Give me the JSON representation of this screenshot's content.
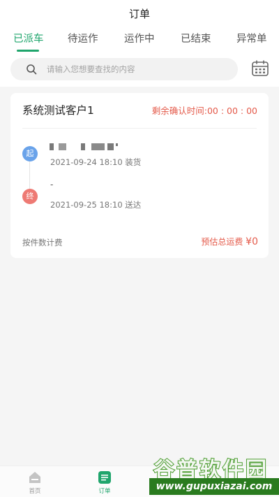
{
  "header": {
    "title": "订单",
    "tabs": [
      {
        "label": "已派车",
        "active": true
      },
      {
        "label": "待运作",
        "active": false
      },
      {
        "label": "运作中",
        "active": false
      },
      {
        "label": "已结束",
        "active": false
      },
      {
        "label": "异常单",
        "active": false
      }
    ]
  },
  "search": {
    "placeholder": "请输入您想要查找的内容",
    "icon": "search-icon",
    "calendar_icon": "calendar-icon"
  },
  "order": {
    "client": "系统测试客户1",
    "countdown_label": "剩余确认时间:",
    "countdown_value": "00 : 00 : 00",
    "start_badge": "起",
    "end_badge": "终",
    "end_address": "-",
    "load_time": "2021-09-24 18:10",
    "load_action": "装货",
    "deliver_time": "2021-09-25 18:10",
    "deliver_action": "送达",
    "pricing_mode": "按件数计费",
    "estimate_label": "预估总运费",
    "estimate_value": "¥0"
  },
  "bottom_nav": {
    "items": [
      {
        "label": "首页",
        "icon": "home-icon",
        "active": false
      },
      {
        "label": "订单",
        "icon": "order-icon",
        "active": true
      }
    ]
  },
  "watermark": {
    "name": "谷普软件园",
    "url": "www.gupuxiazai.com"
  },
  "colors": {
    "accent": "#1fa56c",
    "alert": "#e45a4a",
    "start_badge": "#6aa3ea",
    "end_badge": "#ee7a74"
  }
}
